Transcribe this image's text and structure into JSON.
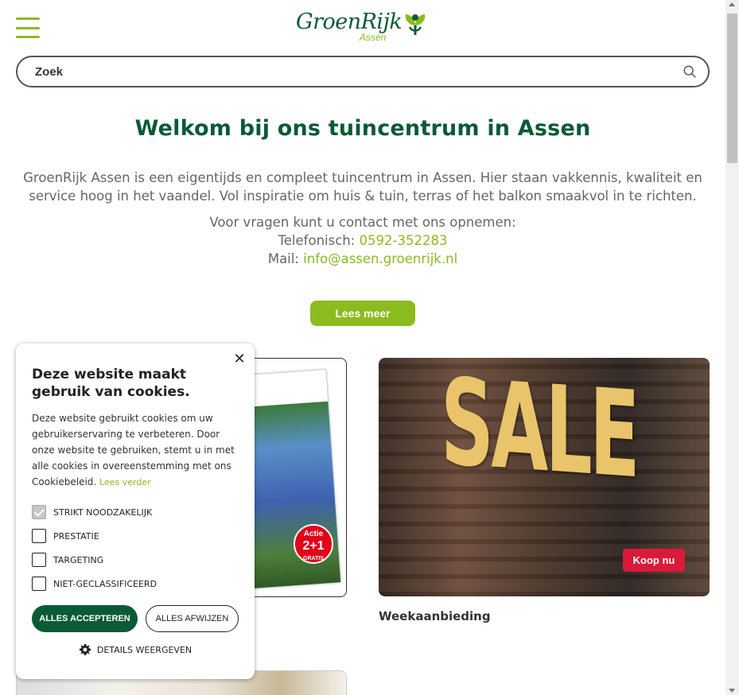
{
  "header": {
    "menu_icon": "hamburger-icon",
    "logo_text": "GroenRijk",
    "logo_sub": "Assen",
    "search_placeholder": "Zoek",
    "search_icon": "search-icon"
  },
  "main": {
    "title": "Welkom bij ons tuincentrum in Assen",
    "intro": "GroenRijk Assen is een eigentijds en compleet tuincentrum in Assen. Hier staan vakkennis, kwaliteit en service hoog in het vaandel.  Vol inspiratie om huis & tuin, terras of het balkon smaakvol in te richten.",
    "contact_line": "Voor vragen kunt u contact met ons opnemen:",
    "phone_label": "Telefonisch: ",
    "phone": "0592-352283",
    "mail_label": "Mail: ",
    "mail": "info@assen.groenrijk.nl",
    "read_more": "Lees meer"
  },
  "cards": {
    "folder_badge_top": "Actie",
    "folder_badge_main": "2+1",
    "folder_badge_sub": "GRATIS",
    "sale_word": "SALE",
    "buy_button": "Koop nu",
    "sale_label": "Weekaanbieding"
  },
  "cookie": {
    "title": "Deze website maakt gebruik van cookies.",
    "body": "Deze website gebruikt cookies om uw gebruikerservaring te verbeteren. Door onze website te gebruiken, stemt u in met alle cookies in overeenstemming met ons Cookiebeleid. ",
    "read_more": "Lees verder",
    "options": [
      {
        "label": "STRIKT NOODZAKELIJK",
        "checked": true
      },
      {
        "label": "PRESTATIE",
        "checked": false
      },
      {
        "label": "TARGETING",
        "checked": false
      },
      {
        "label": "NIET-GECLASSIFICEERD",
        "checked": false
      }
    ],
    "accept": "ALLES ACCEPTEREN",
    "reject": "ALLES AFWIJZEN",
    "details": "DETAILS WEERGEVEN",
    "close_icon": "close-icon",
    "gear_icon": "gear-icon"
  },
  "colors": {
    "brand_green": "#0b5a36",
    "accent_green": "#8cbb1f",
    "sale_red": "#d81b39"
  }
}
